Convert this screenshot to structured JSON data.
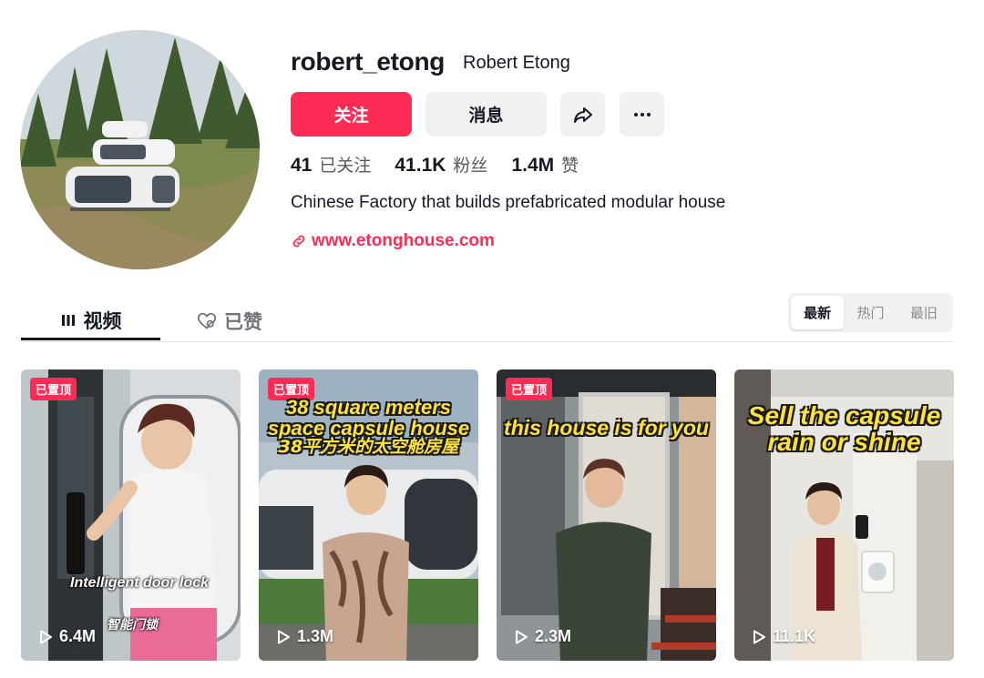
{
  "profile": {
    "username": "robert_etong",
    "nickname": "Robert Etong",
    "follow_label": "关注",
    "message_label": "消息",
    "stats": [
      {
        "num": "41",
        "label": "已关注"
      },
      {
        "num": "41.1K",
        "label": "粉丝"
      },
      {
        "num": "1.4M",
        "label": "赞"
      }
    ],
    "bio": "Chinese Factory that builds prefabricated modular house",
    "link": "www.etonghouse.com"
  },
  "tabs": {
    "videos": "视频",
    "liked": "已赞"
  },
  "sort": {
    "options": [
      "最新",
      "热门",
      "最旧"
    ],
    "selected": "最新"
  },
  "videos": [
    {
      "pinned": "已置顶",
      "views": "6.4M",
      "overlay_en": "Intelligent door lock",
      "overlay_cn": "智能门锁"
    },
    {
      "pinned": "已置顶",
      "views": "1.3M",
      "caption_lines": [
        "38 square meters",
        "space capsule house",
        "38平方米的太空舱房屋"
      ]
    },
    {
      "pinned": "已置顶",
      "views": "2.3M",
      "caption_lines": [
        "this house is for you"
      ]
    },
    {
      "views": "11.1K",
      "caption_lines": [
        "Sell the capsule",
        "rain or shine"
      ]
    }
  ],
  "colors": {
    "accent": "#fe2c55",
    "caption": "#ffe23a"
  }
}
